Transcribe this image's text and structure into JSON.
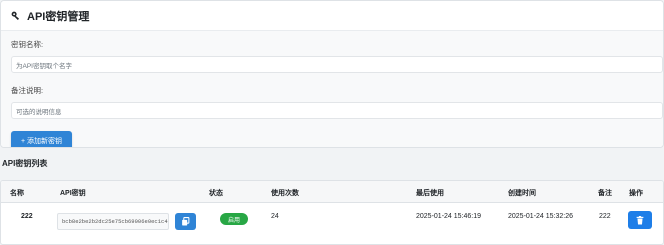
{
  "header": {
    "title": "API密钥管理",
    "icon": "key-icon"
  },
  "form": {
    "name_label": "密钥名称:",
    "name_placeholder": "为API密钥取个名字",
    "desc_label": "备注说明:",
    "desc_placeholder": "可选的说明信息",
    "submit_label": "+ 添加新密钥"
  },
  "list": {
    "title": "API密钥列表",
    "columns": [
      "名称",
      "API密钥",
      "状态",
      "使用次数",
      "最后使用",
      "创建时间",
      "备注",
      "操作"
    ],
    "rows": [
      {
        "name": "222",
        "api_key": "bcb8e2be2b2dc25e75cb69006e0ec1c4",
        "status": "启用",
        "use_count": "24",
        "last_used": "2025-01-24 15:46:19",
        "created": "2025-01-24 15:32:26",
        "note": "222"
      }
    ]
  },
  "colors": {
    "primary": "#2f84d6",
    "success": "#28a745",
    "danger_btn": "#1e7ee8"
  }
}
